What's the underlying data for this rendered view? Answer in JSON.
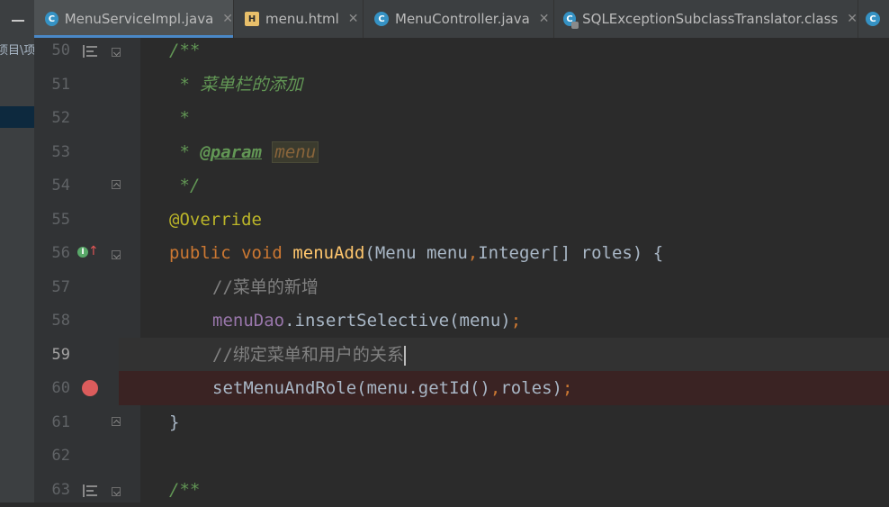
{
  "sidebar": {
    "path_fragment": "项目\\项"
  },
  "tabs": [
    {
      "label": "MenuServiceImpl.java",
      "icon": "java-class-icon",
      "active": true
    },
    {
      "label": "menu.html",
      "icon": "html-file-icon",
      "active": false
    },
    {
      "label": "MenuController.java",
      "icon": "java-class-icon",
      "active": false
    },
    {
      "label": "SQLExceptionSubclassTranslator.class",
      "icon": "compiled-class-icon",
      "active": false
    }
  ],
  "gutter": {
    "line_numbers": [
      "50",
      "51",
      "52",
      "53",
      "54",
      "55",
      "56",
      "57",
      "58",
      "59",
      "60",
      "61",
      "62",
      "63"
    ],
    "current_line": "59",
    "breakpoint_line": "60"
  },
  "code": {
    "l50": "/**",
    "l51": " * 菜单栏的添加",
    "l52": " *",
    "l53_prefix": " * ",
    "l53_tag": "@param",
    "l53_param": "menu",
    "l54": " */",
    "l55": "@Override",
    "l56_kw1": "public",
    "l56_kw2": "void",
    "l56_fn": "menuAdd",
    "l56_rest1": "(Menu menu",
    "l56_comma": ",",
    "l56_rest2": "Integer[] roles) {",
    "l57": "//菜单的新增",
    "l58_field": "menuDao",
    "l58_call": ".insertSelective(menu)",
    "l58_semi": ";",
    "l59": "//绑定菜单和用户的关系",
    "l60_call": "setMenuAndRole(menu.getId()",
    "l60_comma": ",",
    "l60_rest": "roles)",
    "l60_semi": ";",
    "l61": "}",
    "l63": "/**"
  },
  "colors": {
    "editor_bg": "#2b2b2b",
    "keyword": "#cc7832",
    "method": "#ffc66d",
    "doc_comment": "#629755",
    "annotation": "#bbb529",
    "field": "#9876aa"
  }
}
